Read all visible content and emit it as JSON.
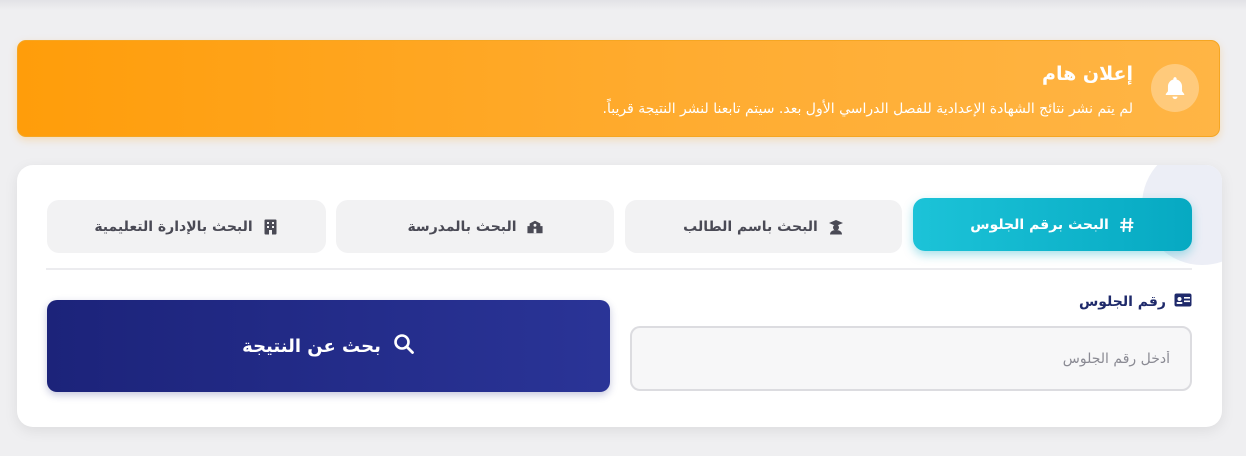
{
  "announcement": {
    "title": "إعلان هام",
    "text": "لم يتم نشر نتائج الشهادة الإعدادية للفصل الدراسي الأول بعد. سيتم تابعنا لنشر النتيجة قريباً.",
    "icon": "bell-icon"
  },
  "tabs": [
    {
      "label": "البحث برقم الجلوس",
      "icon": "hash-icon",
      "active": true
    },
    {
      "label": "البحث باسم الطالب",
      "icon": "graduate-icon",
      "active": false
    },
    {
      "label": "البحث بالمدرسة",
      "icon": "school-icon",
      "active": false
    },
    {
      "label": "البحث بالإدارة التعليمية",
      "icon": "building-icon",
      "active": false
    }
  ],
  "form": {
    "label": "رقم الجلوس",
    "label_icon": "id-card-icon",
    "placeholder": "أدخل رقم الجلوس",
    "value": ""
  },
  "search_button": {
    "label": "بحث عن النتيجة",
    "icon": "search-icon"
  },
  "colors": {
    "banner": "#ff9d0a",
    "tab_active": "#06a9c2",
    "button": "#1c237a",
    "label": "#1f2a6b"
  }
}
